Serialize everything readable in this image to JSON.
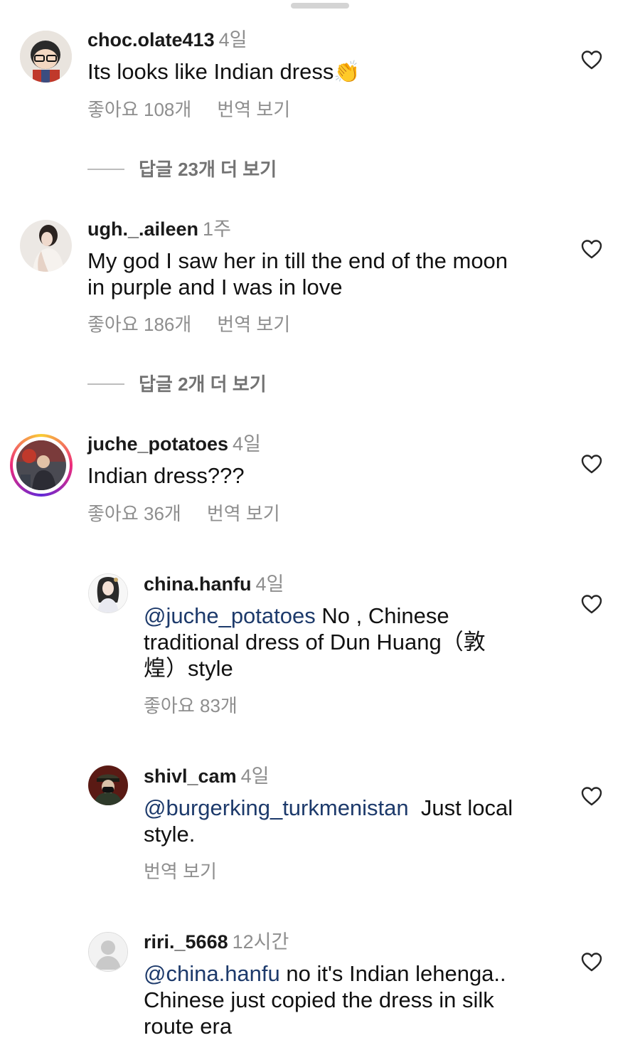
{
  "comments": [
    {
      "username": "choc.olate413",
      "time": "4일",
      "text": "Its looks like Indian dress",
      "emoji": "👏",
      "likes": "좋아요 108개",
      "translate": "번역 보기",
      "more_replies": "답글 23개 더 보기"
    },
    {
      "username": "ugh._.aileen",
      "time": "1주",
      "text_line1": "My god I saw her in till the end of the moon",
      "text_line2": "in purple and I was in love",
      "likes": "좋아요 186개",
      "translate": "번역 보기",
      "more_replies": "답글 2개 더 보기"
    },
    {
      "username": "juche_potatoes",
      "time": "4일",
      "text": "Indian dress???",
      "likes": "좋아요 36개",
      "translate": "번역 보기"
    }
  ],
  "replies": [
    {
      "username": "china.hanfu",
      "time": "4일",
      "mention": "@juche_potatoes",
      "text_line1": " No , Chinese",
      "text_line2": "traditional dress of Dun Huang（敦",
      "text_line3": "煌）style",
      "likes": "좋아요 83개"
    },
    {
      "username": "shivl_cam",
      "time": "4일",
      "mention": "@burgerking_turkmenistan",
      "text_line1": "  Just local",
      "text_line2": "style.",
      "translate": "번역 보기"
    },
    {
      "username": "riri._5668",
      "time": "12시간",
      "mention": "@china.hanfu",
      "text_line1": " no it's Indian lehenga..",
      "text_line2": "Chinese just copied the dress in silk",
      "text_line3": "route era"
    }
  ],
  "icons": {
    "like": "heart-icon",
    "avatar_default": "default-avatar-icon"
  },
  "colors": {
    "mention": "#1d3a6b",
    "muted": "#8e8e8e",
    "story_ring": "#ee2a7b"
  }
}
